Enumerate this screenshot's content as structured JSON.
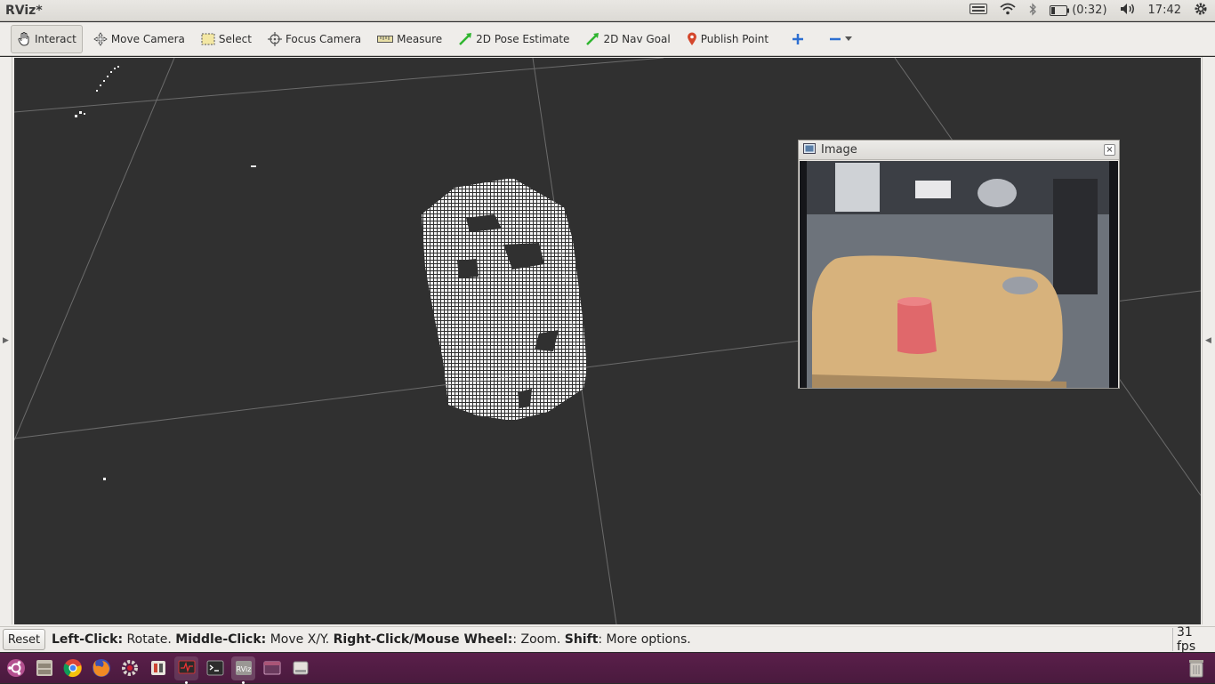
{
  "window": {
    "title": "RViz*"
  },
  "tray": {
    "battery_text": "(0:32)",
    "clock": "17:42"
  },
  "toolbar": {
    "tools": [
      {
        "label": "Interact",
        "icon": "hand-icon"
      },
      {
        "label": "Move Camera",
        "icon": "move-camera-icon"
      },
      {
        "label": "Select",
        "icon": "select-icon"
      },
      {
        "label": "Focus Camera",
        "icon": "focus-camera-icon"
      },
      {
        "label": "Measure",
        "icon": "ruler-icon"
      },
      {
        "label": "2D Pose Estimate",
        "icon": "pose-arrow-icon"
      },
      {
        "label": "2D Nav Goal",
        "icon": "nav-arrow-icon"
      },
      {
        "label": "Publish Point",
        "icon": "map-pin-icon"
      }
    ]
  },
  "image_panel": {
    "title": "Image",
    "close": "×"
  },
  "status": {
    "reset_label": "Reset",
    "hint_left_click": "Left-Click:",
    "hint_rotate": " Rotate. ",
    "hint_middle_click": "Middle-Click:",
    "hint_move": " Move X/Y. ",
    "hint_right_click": "Right-Click/Mouse Wheel:",
    "hint_zoom": ": Zoom. ",
    "hint_shift": "Shift",
    "hint_more": ": More options.",
    "fps": "31 fps"
  },
  "colors": {
    "accent_green": "#2fb52f",
    "pin_red": "#d4472c",
    "launcher": "#4f1c42",
    "viewport_bg": "#303030"
  }
}
